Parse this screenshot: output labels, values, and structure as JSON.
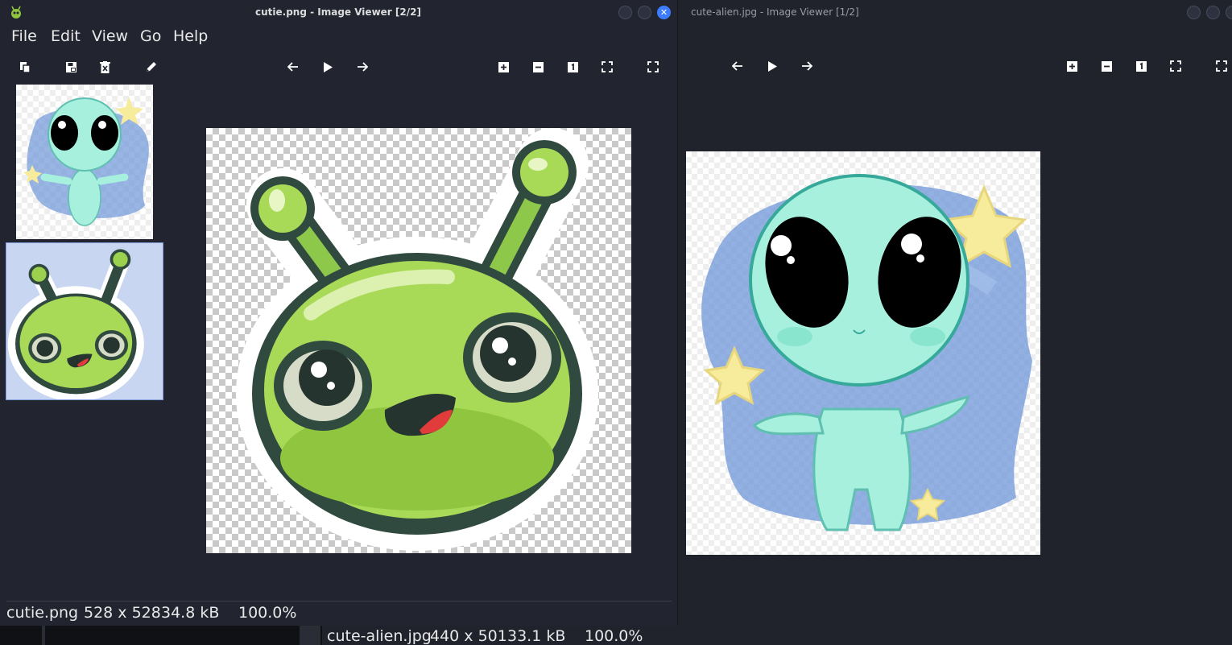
{
  "window1": {
    "title": "cutie.png - Image Viewer [2/2]",
    "menu": [
      "File",
      "Edit",
      "View",
      "Go",
      "Help"
    ],
    "toolbar_icons": [
      "copy-icon",
      "save-icon",
      "delete-icon",
      "edit-icon",
      "prev-icon",
      "play-icon",
      "next-icon",
      "zoom-in-icon",
      "zoom-out-icon",
      "zoom-100-icon",
      "zoom-fit-icon",
      "fullscreen-icon"
    ],
    "thumbnails": [
      {
        "name": "cute-alien.jpg",
        "selected": false
      },
      {
        "name": "cutie.png",
        "selected": true
      }
    ],
    "status": {
      "filename": "cutie.png",
      "dimensions": "528 x 528",
      "size": "34.8 kB",
      "zoom": "100.0%"
    }
  },
  "window2": {
    "title": "cute-alien.jpg - Image Viewer [1/2]",
    "toolbar_icons": [
      "prev-icon",
      "play-icon",
      "next-icon",
      "zoom-in-icon",
      "zoom-out-icon",
      "zoom-100-icon",
      "zoom-fit-icon",
      "fullscreen-icon"
    ],
    "status": {
      "filename": "cute-alien.jpg",
      "dimensions": "440 x 501",
      "size": "33.1 kB",
      "zoom": "100.0%"
    }
  },
  "colors": {
    "accent": "#3d7cff",
    "selection": "#c8d6f2",
    "alien_green": "#a8d957",
    "alien_cyan": "#a6f0dd"
  }
}
